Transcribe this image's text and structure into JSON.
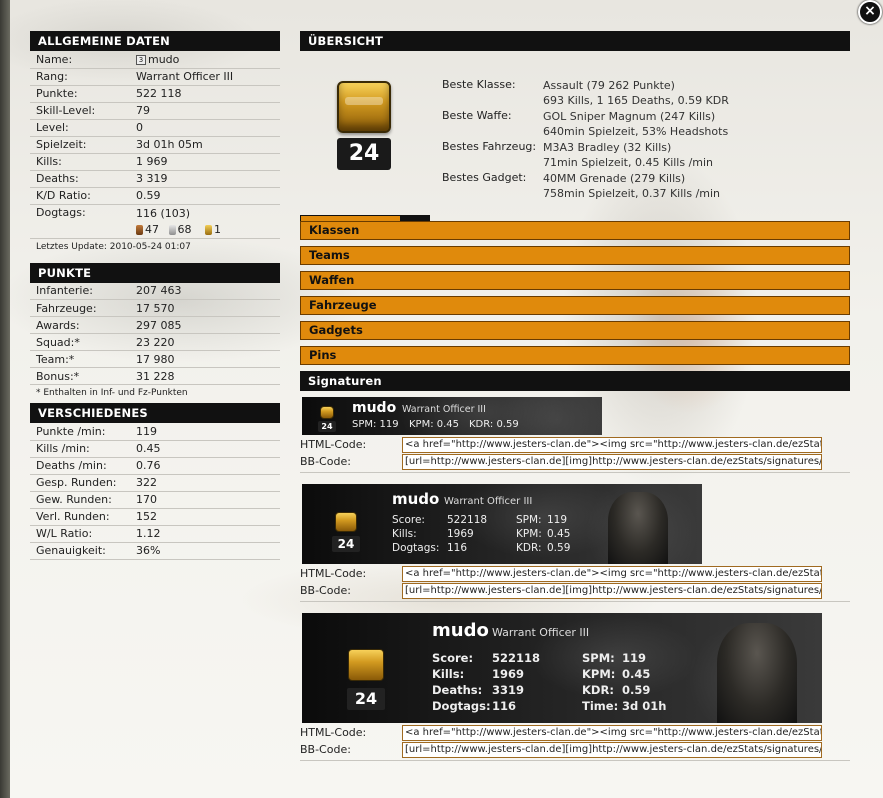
{
  "close_label": "×",
  "allgemeine": {
    "title": "ALLGEMEINE DATEN",
    "rows": [
      {
        "k": "Name:",
        "v": "mudo"
      },
      {
        "k": "Rang:",
        "v": "Warrant Officer III"
      },
      {
        "k": "Punkte:",
        "v": "522 118"
      },
      {
        "k": "Skill-Level:",
        "v": "79"
      },
      {
        "k": "Level:",
        "v": "0"
      },
      {
        "k": "Spielzeit:",
        "v": "3d 01h 05m"
      },
      {
        "k": "Kills:",
        "v": "1 969"
      },
      {
        "k": "Deaths:",
        "v": "3 319"
      },
      {
        "k": "K/D Ratio:",
        "v": "0.59"
      }
    ],
    "rank_badge": "3",
    "dogtags_label": "Dogtags:",
    "dogtags_value": "116 (103)",
    "dogtags_bronze": "47",
    "dogtags_silver": "68",
    "dogtags_gold": "1",
    "update": "Letztes Update: 2010-05-24 01:07"
  },
  "punkte": {
    "title": "PUNKTE",
    "rows": [
      {
        "k": "Infanterie:",
        "v": "207 463"
      },
      {
        "k": "Fahrzeuge:",
        "v": "17 570"
      },
      {
        "k": "Awards:",
        "v": "297 085"
      },
      {
        "k": "Squad:*",
        "v": "23 220"
      },
      {
        "k": "Team:*",
        "v": "17 980"
      },
      {
        "k": "Bonus:*",
        "v": "31 228"
      }
    ],
    "note": "* Enthalten in Inf- und Fz-Punkten"
  },
  "verschiedenes": {
    "title": "VERSCHIEDENES",
    "rows": [
      {
        "k": "Punkte /min:",
        "v": "119"
      },
      {
        "k": "Kills /min:",
        "v": "0.45"
      },
      {
        "k": "Deaths /min:",
        "v": "0.76"
      },
      {
        "k": "Gesp. Runden:",
        "v": "322"
      },
      {
        "k": "Gew. Runden:",
        "v": "170"
      },
      {
        "k": "Verl. Runden:",
        "v": "152"
      },
      {
        "k": "W/L Ratio:",
        "v": "1.12"
      },
      {
        "k": "Genauigkeit:",
        "v": "36%"
      }
    ]
  },
  "uebersicht": {
    "title": "ÜBERSICHT",
    "rank_number": "24",
    "progress_fraction": 0.77,
    "rows": [
      {
        "k": "Beste Klasse:",
        "v1": "Assault (79 262 Punkte)",
        "v2": "693 Kills, 1 165 Deaths, 0.59 KDR"
      },
      {
        "k": "Beste Waffe:",
        "v1": "GOL Sniper Magnum (247 Kills)",
        "v2": "640min Spielzeit, 53% Headshots"
      },
      {
        "k": "Bestes Fahrzeug:",
        "v1": "M3A3 Bradley (32 Kills)",
        "v2": "71min Spielzeit, 0.45 Kills /min"
      },
      {
        "k": "Bestes Gadget:",
        "v1": "40MM Grenade (279 Kills)",
        "v2": "758min Spielzeit, 0.37 Kills /min"
      }
    ]
  },
  "sections": [
    "Klassen",
    "Teams",
    "Waffen",
    "Fahrzeuge",
    "Gadgets",
    "Pins"
  ],
  "signaturen": {
    "title": "Signaturen",
    "html_label": "HTML-Code:",
    "bb_label": "BB-Code:",
    "html_code": "<a href=\"http://www.jesters-clan.de\"><img src=\"http://www.jesters-clan.de/ezStats/signatures/",
    "bb_code": "[url=http://www.jesters-clan.de][img]http://www.jesters-clan.de/ezStats/signatures/S",
    "small": {
      "name": "mudo",
      "rank": "Warrant Officer III",
      "rank_number": "24",
      "spm": "SPM: 119",
      "kpm": "KPM: 0.45",
      "kdr": "KDR: 0.59"
    },
    "medium": {
      "name": "mudo",
      "rank": "Warrant Officer III",
      "rank_number": "24",
      "score_l": "Score:",
      "score_v": "522118",
      "kills_l": "Kills:",
      "kills_v": "1969",
      "dogtags_l": "Dogtags:",
      "dogtags_v": "116",
      "spm_l": "SPM:",
      "spm_v": "119",
      "kpm_l": "KPM:",
      "kpm_v": "0.45",
      "kdr_l": "KDR:",
      "kdr_v": "0.59"
    },
    "large": {
      "name": "mudo",
      "rank": "Warrant Officer III",
      "rank_number": "24",
      "score_l": "Score:",
      "score_v": "522118",
      "kills_l": "Kills:",
      "kills_v": "1969",
      "deaths_l": "Deaths:",
      "deaths_v": "3319",
      "dogtags_l": "Dogtags:",
      "dogtags_v": "116",
      "spm_l": "SPM:",
      "spm_v": "119",
      "kpm_l": "KPM:",
      "kpm_v": "0.45",
      "kdr_l": "KDR:",
      "kdr_v": "0.59",
      "time_l": "Time:",
      "time_v": "3d 01h"
    }
  }
}
